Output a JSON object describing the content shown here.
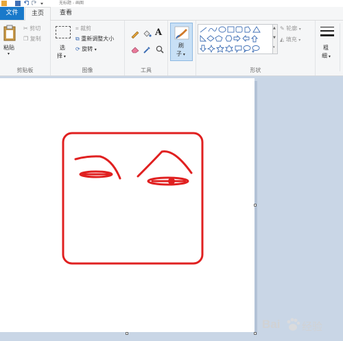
{
  "window": {
    "title": "无标题 - 画图"
  },
  "tabs": {
    "file": "文件",
    "home": "主页",
    "view": "查看"
  },
  "clipboard": {
    "paste": "粘贴",
    "cut": "剪切",
    "copy": "复制",
    "group": "剪贴板"
  },
  "image": {
    "select": "选",
    "select2": "择",
    "crop": "裁剪",
    "resize": "重新调整大小",
    "rotate": "旋转",
    "group": "图像"
  },
  "tools": {
    "group": "工具"
  },
  "brushes": {
    "label": "刷",
    "label2": "子"
  },
  "shapes": {
    "outline": "轮廓",
    "fill": "填充",
    "group": "形状"
  },
  "size": {
    "label": "粗",
    "label2": "细"
  },
  "watermark": {
    "brand": "Bai",
    "suffix": "经验"
  },
  "colors": {
    "accent": "#1979ca",
    "drawing": "#e02020"
  }
}
